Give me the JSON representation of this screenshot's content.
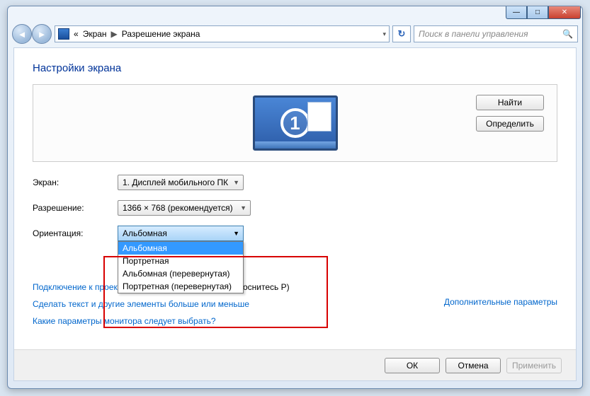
{
  "titlebar": {
    "min": "—",
    "max": "□",
    "close": "✕"
  },
  "nav": {
    "back": "◄",
    "forward": "►"
  },
  "breadcrumb": {
    "prefix": "«",
    "items": [
      "Экран",
      "Разрешение экрана"
    ]
  },
  "refresh_glyph": "↻",
  "search": {
    "placeholder": "Поиск в панели управления",
    "icon": "🔍"
  },
  "page_title": "Настройки экрана",
  "monitor_number": "1",
  "buttons": {
    "detect": "Найти",
    "identify": "Определить"
  },
  "rows": {
    "display_label": "Экран:",
    "display_value": "1. Дисплей мобильного ПК",
    "resolution_label": "Разрешение:",
    "resolution_value": "1366 × 768 (рекомендуется)",
    "orientation_label": "Ориентация:",
    "orientation_value": "Альбомная"
  },
  "orientation_options": [
    "Альбомная",
    "Портретная",
    "Альбомная (перевернутая)",
    "Портретная (перевернутая)"
  ],
  "links": {
    "advanced": "Дополнительные параметры",
    "projector_prefix": "Подключение к проек",
    "projector_suffix": "и коснитесь P)",
    "text_size": "Сделать текст и другие элементы больше или меньше",
    "which_monitor": "Какие параметры монитора следует выбрать?"
  },
  "footer": {
    "ok": "ОК",
    "cancel": "Отмена",
    "apply": "Применить"
  }
}
